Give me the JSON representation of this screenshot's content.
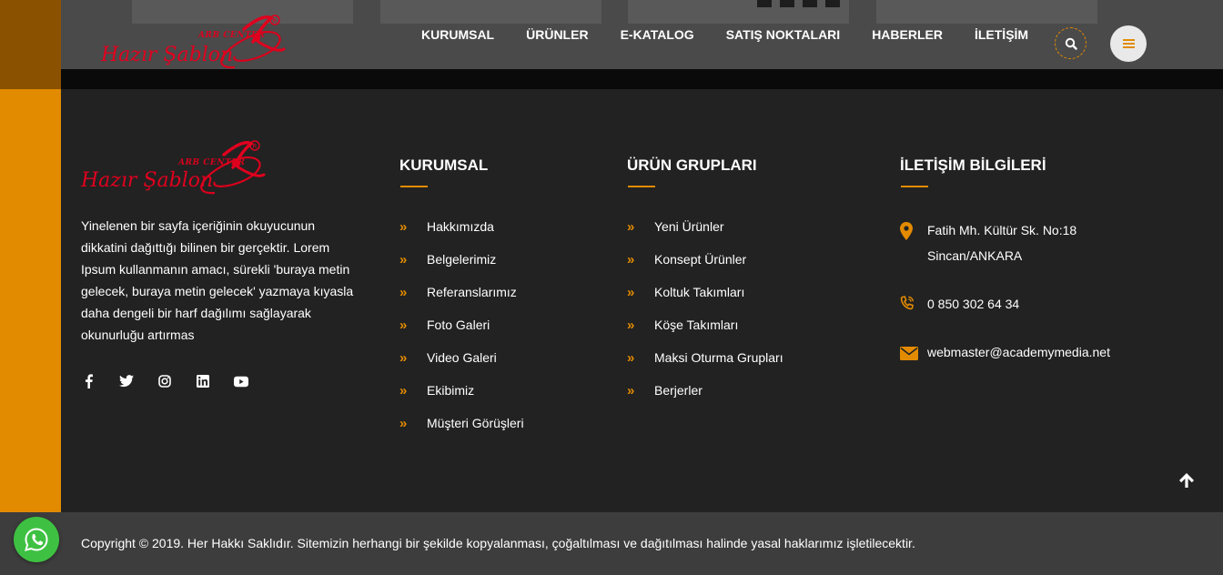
{
  "header": {
    "logo": {
      "small": "ARB CENTER",
      "main": "Hazır Şablon"
    },
    "nav": [
      {
        "label": "KURUMSAL"
      },
      {
        "label": "ÜRÜNLER"
      },
      {
        "label": "E-KATALOG"
      },
      {
        "label": "SATIŞ NOKTALARI"
      },
      {
        "label": "HABERLER"
      },
      {
        "label": "İLETİŞİM"
      }
    ],
    "search_icon": "search-icon",
    "menu_icon": "hamburger-icon"
  },
  "footer": {
    "logo": {
      "small": "ARB CENTER",
      "main": "Hazır Şablon"
    },
    "description": "Yinelenen bir sayfa içeriğinin okuyucunun dikkatini dağıttığı bilinen bir gerçektir. Lorem Ipsum kullanmanın amacı, sürekli 'buraya metin gelecek, buraya metin gelecek' yazmaya kıyasla daha dengeli bir harf dağılımı sağlayarak okunurluğu artırmas",
    "social": [
      "facebook-icon",
      "twitter-icon",
      "instagram-icon",
      "linkedin-icon",
      "youtube-icon"
    ],
    "corporate": {
      "title": "KURUMSAL",
      "links": [
        "Hakkımızda",
        "Belgelerimiz",
        "Referanslarımız",
        "Foto Galeri",
        "Video Galeri",
        "Ekibimiz",
        "Müşteri Görüşleri"
      ]
    },
    "product_groups": {
      "title": "ÜRÜN GRUPLARI",
      "links": [
        "Yeni Ürünler",
        "Konsept Ürünler",
        "Koltuk Takımları",
        "Köşe Takımları",
        "Maksi Oturma Grupları",
        "Berjerler"
      ]
    },
    "contact": {
      "title": "İLETİŞİM BİLGİLERİ",
      "address_line1": "Fatih Mh. Kültür Sk. No:18",
      "address_line2": "Sincan/ANKARA",
      "phone": "0 850 302 64 34",
      "email": "webmaster@academymedia.net"
    },
    "copyright": "Copyright © 2019. Her Hakkı Saklıdır. Sitemizin herhangi bir şekilde kopyalanması, çoğaltılması ve dağıtılması halinde yasal haklarımız işletilecektir."
  },
  "colors": {
    "accent": "#e38b00",
    "brand_red": "#e0001e",
    "whatsapp": "#3ec142",
    "footer_bg": "#222222",
    "header_bg": "#4a4a4a"
  }
}
